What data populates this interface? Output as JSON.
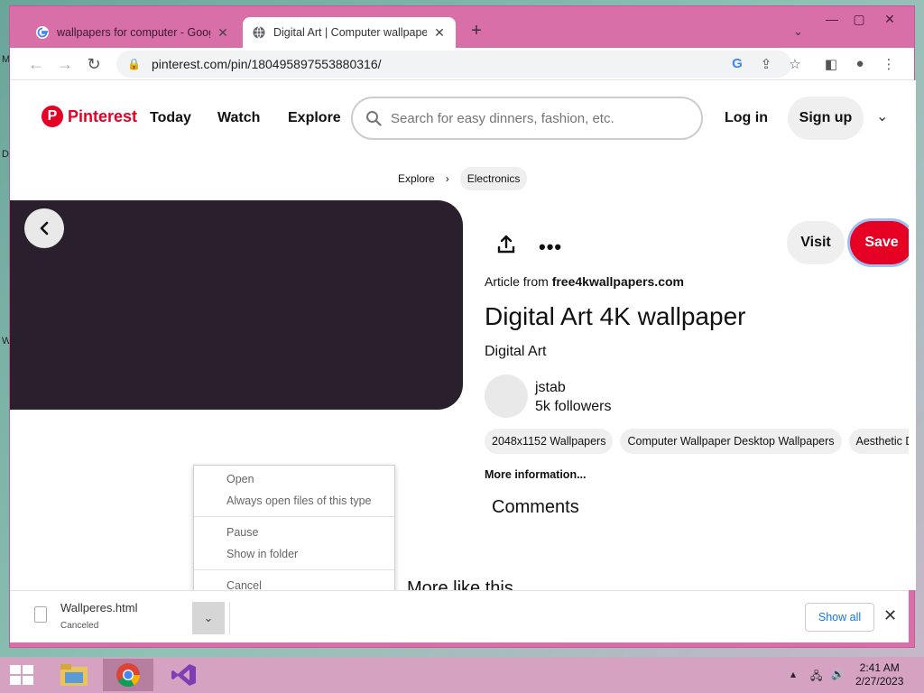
{
  "browser": {
    "tabs": [
      {
        "title": "wallpapers for computer - Goog"
      },
      {
        "title": "Digital Art | Computer wallpaper"
      }
    ],
    "url": "pinterest.com/pin/180495897553880316/"
  },
  "header": {
    "brand": "Pinterest",
    "nav": [
      "Today",
      "Watch",
      "Explore"
    ],
    "search_placeholder": "Search for easy dinners, fashion, etc.",
    "login": "Log in",
    "signup": "Sign up"
  },
  "breadcrumb": {
    "root": "Explore",
    "current": "Electronics"
  },
  "pin": {
    "visit_label": "Visit",
    "save_label": "Save",
    "article_prefix": "Article from",
    "article_source": "free4kwallpapers.com",
    "title": "Digital Art 4K wallpaper",
    "subtitle": "Digital Art",
    "user": "jstab",
    "followers": "5k followers",
    "tags": [
      "2048x1152 Wallpapers",
      "Computer Wallpaper Desktop Wallpapers",
      "Aesthetic Desk"
    ],
    "more_info": "More information...",
    "comments_heading": "Comments",
    "more_like_this": "More like this"
  },
  "context_menu": {
    "items": [
      "Open",
      "Always open files of this type",
      "Pause",
      "Show in folder",
      "Cancel"
    ]
  },
  "download": {
    "file_name": "Wallperes.html",
    "status": "Canceled",
    "show_all": "Show all"
  },
  "taskbar": {
    "time": "2:41 AM",
    "date": "2/27/2023"
  },
  "colors": {
    "brand_red": "#e60023",
    "window_frame": "#d96fa8",
    "link_blue": "#1a73e8"
  }
}
